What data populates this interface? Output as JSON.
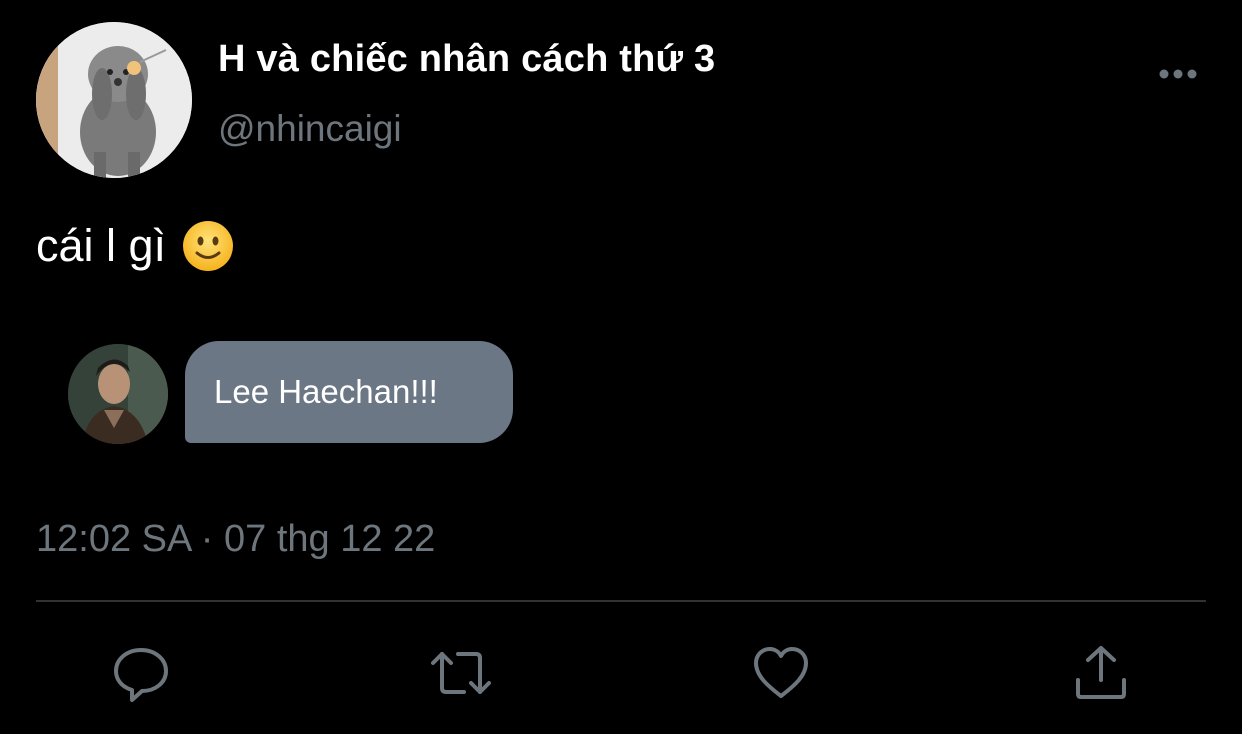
{
  "tweet": {
    "display_name": "H và chiếc nhân cách thứ 3",
    "handle": "@nhincaigi",
    "text": "cái l gì",
    "emoji_icon": "slightly-smiling-face-emoji",
    "embedded_message": {
      "text": "Lee Haechan!!!"
    },
    "timestamp": "12:02 SA · 07 thg 12 22"
  },
  "icons": {
    "more": "more-horizontal-icon",
    "reply": "comment-icon",
    "retweet": "retweet-icon",
    "like": "heart-icon",
    "share": "share-upload-icon"
  },
  "colors": {
    "background": "#000000",
    "text_primary": "#ffffff",
    "text_secondary": "#6e767d",
    "bubble": "#6b7785",
    "divider": "#2f3336"
  }
}
